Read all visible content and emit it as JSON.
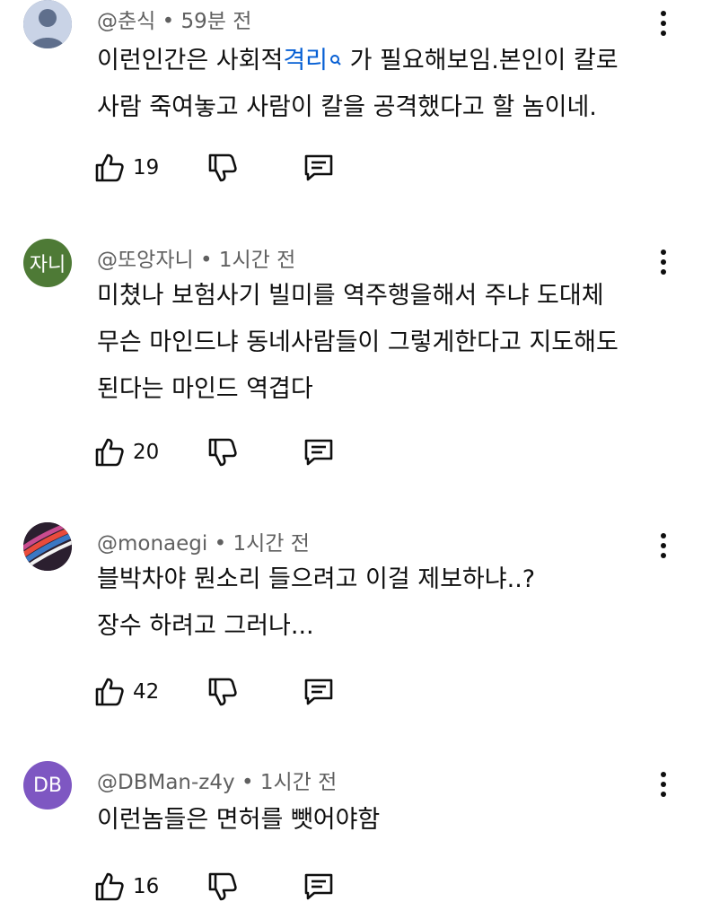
{
  "comments": [
    {
      "avatar_text": "",
      "avatar_color": "#5f6f8c",
      "author": "@춘식",
      "separator": "•",
      "time": "59분 전",
      "lines": [
        {
          "pre": "이런인간은 사회적",
          "link": "격리",
          "post": " 가 필요해보임.본인이 칼로"
        },
        {
          "text": "사람 죽여놓고 사람이 칼을 공격했다고 할 놈이네."
        }
      ],
      "likes": "19"
    },
    {
      "avatar_text": "자니",
      "avatar_color": "#4e7a36",
      "author": "@또앙자니",
      "separator": "•",
      "time": "1시간 전",
      "lines": [
        {
          "text": "미쳤나 보험사기 빌미를 역주행을해서 주냐 도대체"
        },
        {
          "text": "무슨 마인드냐 동네사람들이 그렇게한다고 지도해도"
        },
        {
          "text": "된다는 마인드 역겹다"
        }
      ],
      "likes": "20"
    },
    {
      "avatar_text": "",
      "avatar_color": "#3a2a3a",
      "author": "@monaegi",
      "separator": "•",
      "time": "1시간 전",
      "lines": [
        {
          "text": "블박차야 뭔소리 들으려고 이걸 제보하냐..?"
        },
        {
          "text": "장수 하려고 그러나..."
        }
      ],
      "likes": "42"
    },
    {
      "avatar_text": "DB",
      "avatar_color": "#7e57c2",
      "author": "@DBMan-z4y",
      "separator": "•",
      "time": "1시간 전",
      "lines": [
        {
          "text": "이런놈들은 면허를 뺏어야함"
        }
      ],
      "likes": "16"
    }
  ],
  "icons": {
    "like": "thumb-up-icon",
    "dislike": "thumb-down-icon",
    "reply": "reply-icon",
    "more": "more-vert-icon",
    "search": "search-icon"
  }
}
